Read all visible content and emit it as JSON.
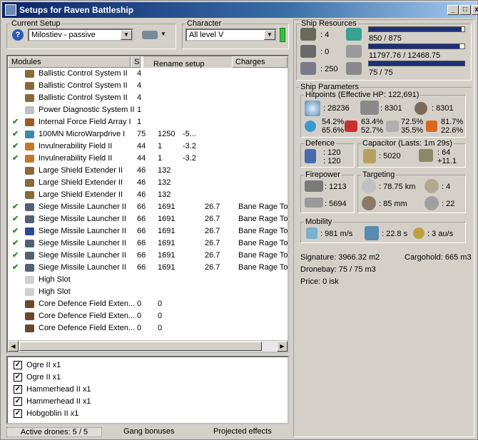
{
  "window": {
    "title": "Setups for Raven Battleship",
    "min": "_",
    "max": "□",
    "close": "x"
  },
  "setup": {
    "label": "Current Setup",
    "value": "Milostiev - passive"
  },
  "character": {
    "label": "Character",
    "value": "All level V"
  },
  "menu": {
    "rename": "Rename setup"
  },
  "modules": {
    "headers": {
      "name": "Modules",
      "charges": "Charges"
    },
    "rows": [
      {
        "check": "",
        "name": "Ballistic Control System II",
        "c1": "4",
        "c2": "",
        "c3": "",
        "c4": "",
        "charge": "",
        "color": "#8a6a3a"
      },
      {
        "check": "",
        "name": "Ballistic Control System II",
        "c1": "4",
        "c2": "",
        "c3": "",
        "c4": "",
        "charge": "",
        "color": "#8a6a3a"
      },
      {
        "check": "",
        "name": "Ballistic Control System II",
        "c1": "4",
        "c2": "",
        "c3": "",
        "c4": "",
        "charge": "",
        "color": "#8a6a3a"
      },
      {
        "check": "",
        "name": "Power Diagnostic System II",
        "c1": "1",
        "c2": "",
        "c3": "",
        "c4": "",
        "charge": "",
        "color": "#c0c0c0"
      },
      {
        "check": "✔",
        "name": "Internal Force Field Array I",
        "c1": "1",
        "c2": "",
        "c3": "",
        "c4": "",
        "charge": "",
        "color": "#a05a2a"
      },
      {
        "check": "✔",
        "name": "100MN MicroWarpdrive I",
        "c1": "75",
        "c2": "1250",
        "c3": "-5...",
        "c4": "",
        "charge": "",
        "color": "#3a8ab0"
      },
      {
        "check": "✔",
        "name": "Invulnerability Field II",
        "c1": "44",
        "c2": "1",
        "c3": "-3.2",
        "c4": "",
        "charge": "",
        "color": "#c07a2a"
      },
      {
        "check": "✔",
        "name": "Invulnerability Field II",
        "c1": "44",
        "c2": "1",
        "c3": "-3.2",
        "c4": "",
        "charge": "",
        "color": "#c07a2a"
      },
      {
        "check": "",
        "name": "Large Shield Extender II",
        "c1": "46",
        "c2": "132",
        "c3": "",
        "c4": "",
        "charge": "",
        "color": "#8a6a3a"
      },
      {
        "check": "",
        "name": "Large Shield Extender II",
        "c1": "46",
        "c2": "132",
        "c3": "",
        "c4": "",
        "charge": "",
        "color": "#8a6a3a"
      },
      {
        "check": "",
        "name": "Large Shield Extender II",
        "c1": "46",
        "c2": "132",
        "c3": "",
        "c4": "",
        "charge": "",
        "color": "#8a6a3a"
      },
      {
        "check": "✔",
        "name": "Siege Missile Launcher II",
        "c1": "66",
        "c2": "1691",
        "c3": "",
        "c4": "26.7",
        "charge": "Bane Rage Tor",
        "color": "#556070"
      },
      {
        "check": "✔",
        "name": "Siege Missile Launcher II",
        "c1": "66",
        "c2": "1691",
        "c3": "",
        "c4": "26.7",
        "charge": "Bane Rage Tor",
        "color": "#556070"
      },
      {
        "check": "✔",
        "name": "Siege Missile Launcher II",
        "c1": "66",
        "c2": "1691",
        "c3": "",
        "c4": "26.7",
        "charge": "Bane Rage Tor",
        "color": "#2a4a90"
      },
      {
        "check": "✔",
        "name": "Siege Missile Launcher II",
        "c1": "66",
        "c2": "1691",
        "c3": "",
        "c4": "26.7",
        "charge": "Bane Rage Tor",
        "color": "#556070"
      },
      {
        "check": "✔",
        "name": "Siege Missile Launcher II",
        "c1": "66",
        "c2": "1691",
        "c3": "",
        "c4": "26.7",
        "charge": "Bane Rage Tor",
        "color": "#556070"
      },
      {
        "check": "✔",
        "name": "Siege Missile Launcher II",
        "c1": "66",
        "c2": "1691",
        "c3": "",
        "c4": "26.7",
        "charge": "Bane Rage Tor",
        "color": "#556070"
      },
      {
        "check": "",
        "name": "High Slot",
        "c1": "",
        "c2": "",
        "c3": "",
        "c4": "",
        "charge": "",
        "color": "#d0d0d0"
      },
      {
        "check": "",
        "name": "High Slot",
        "c1": "",
        "c2": "",
        "c3": "",
        "c4": "",
        "charge": "",
        "color": "#d0d0d0"
      },
      {
        "check": "",
        "name": "Core Defence Field Exten...",
        "c1": "0",
        "c2": "0",
        "c3": "",
        "c4": "",
        "charge": "",
        "color": "#6a4a2a"
      },
      {
        "check": "",
        "name": "Core Defence Field Exten...",
        "c1": "0",
        "c2": "0",
        "c3": "",
        "c4": "",
        "charge": "",
        "color": "#6a4a2a"
      },
      {
        "check": "",
        "name": "Core Defence Field Exten...",
        "c1": "0",
        "c2": "0",
        "c3": "",
        "c4": "",
        "charge": "",
        "color": "#6a4a2a"
      }
    ]
  },
  "drones": [
    {
      "name": "Ogre II x1"
    },
    {
      "name": "Ogre II x1"
    },
    {
      "name": "Hammerhead II x1"
    },
    {
      "name": "Hammerhead II x1"
    },
    {
      "name": "Hobgoblin II x1"
    }
  ],
  "tabs": {
    "active_drones": "Active drones: 5 / 5",
    "gang": "Gang bonuses",
    "projected": "Projected effects"
  },
  "resources": {
    "label": "Ship Resources",
    "hi": ": 4",
    "med": ": 0",
    "low": ": 250",
    "cpu": "850 / 875",
    "pg": "11797.76 / 12468.75",
    "calib": "75 / 75",
    "cpu_fill": 0.97,
    "pg_fill": 0.95,
    "calib_fill": 1.0
  },
  "params": {
    "label": "Ship Parameters",
    "hp": {
      "label": "Hitpoints (Effective HP: 122,691)",
      "shield": ": 28236",
      "armor": ": 8301",
      "hull": ": 8301",
      "r1a": "54.2%",
      "r1b": "65.6%",
      "r2a": "63.4%",
      "r2b": "52.7%",
      "r3a": "72.5%",
      "r3b": "35.5%",
      "r4a": "81.7%",
      "r4b": "22.6%"
    },
    "defence": {
      "label": "Defence",
      "a": ": 120",
      "b": ": 120"
    },
    "capacitor": {
      "label": "Capacitor (Lasts: 1m 29s)",
      "cap": ": 5020",
      "r1": ": 64",
      "r2": "+11.1"
    },
    "firepower": {
      "label": "Firepower",
      "a": ": 1213",
      "b": ": 5694"
    },
    "targeting": {
      "label": "Targeting",
      "range": ": 78.75 km",
      "targets": ": 4",
      "sig": ": 85 mm",
      "scan": ": 22"
    },
    "mobility": {
      "label": "Mobility",
      "speed": ": 981 m/s",
      "align": ": 22.8 s",
      "warp": ": 3 au/s"
    },
    "signature": "Signature: 3966.32 m2",
    "cargo": "Cargohold: 665 m3",
    "drone": "Dronebay: 75 / 75 m3",
    "price": "Price: 0 isk"
  }
}
